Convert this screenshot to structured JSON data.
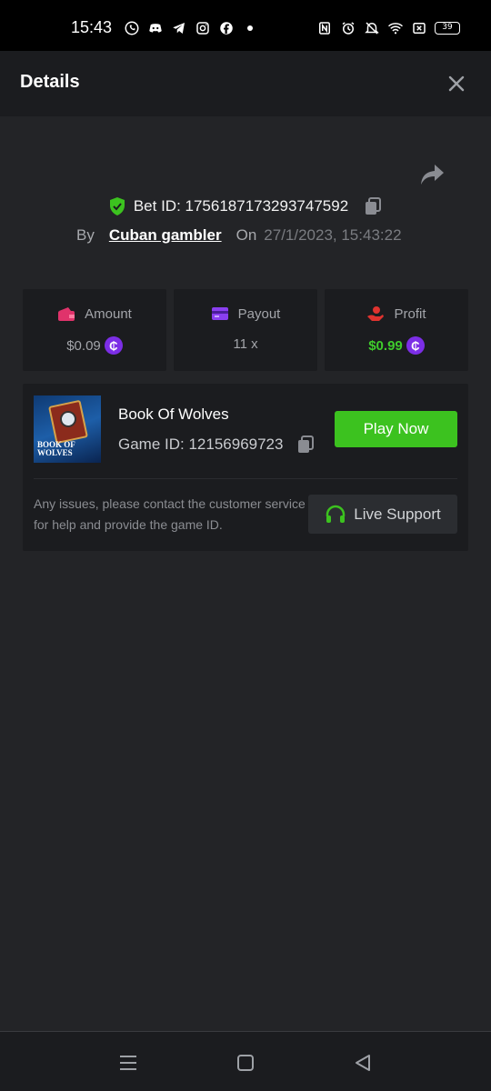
{
  "status_bar": {
    "time": "15:43",
    "left_icons": [
      "whatsapp-icon",
      "discord-icon",
      "telegram-icon",
      "instagram-icon",
      "facebook-icon"
    ],
    "right_icons": [
      "nfc-icon",
      "alarm-icon",
      "bell-muted-icon",
      "wifi-icon",
      "cross-box-icon"
    ],
    "battery": "39"
  },
  "header": {
    "title": "Details"
  },
  "bet": {
    "bet_id_text": "Bet ID: 1756187173293747592",
    "by_label": "By",
    "user": "Cuban gambler",
    "on_label": "On",
    "date": "27/1/2023, 15:43:22"
  },
  "stats": [
    {
      "label": "Amount",
      "value": "$0.09",
      "icon": "wallet-icon",
      "has_coin": true
    },
    {
      "label": "Payout",
      "value": "11 x",
      "icon": "card-icon",
      "has_coin": false
    },
    {
      "label": "Profit",
      "value": "$0.99",
      "icon": "hand-money-icon",
      "has_coin": true
    }
  ],
  "coin_symbol": "₵",
  "game": {
    "name": "Book Of Wolves",
    "game_id_text": "Game ID: 12156969723",
    "thumb_title": "BOOK OF WOLVES",
    "play_label": "Play Now",
    "support_text": "Any issues, please contact the customer service for help and provide the game ID.",
    "support_label": "Live Support"
  },
  "colors": {
    "background": "#232427",
    "card": "#1b1c1f",
    "accent_green": "#3cc21f",
    "coin_purple": "#7c2ee6",
    "amount_icon": "#e0336b",
    "payout_icon": "#8a3ff0",
    "profit_icon": "#e0332f"
  }
}
